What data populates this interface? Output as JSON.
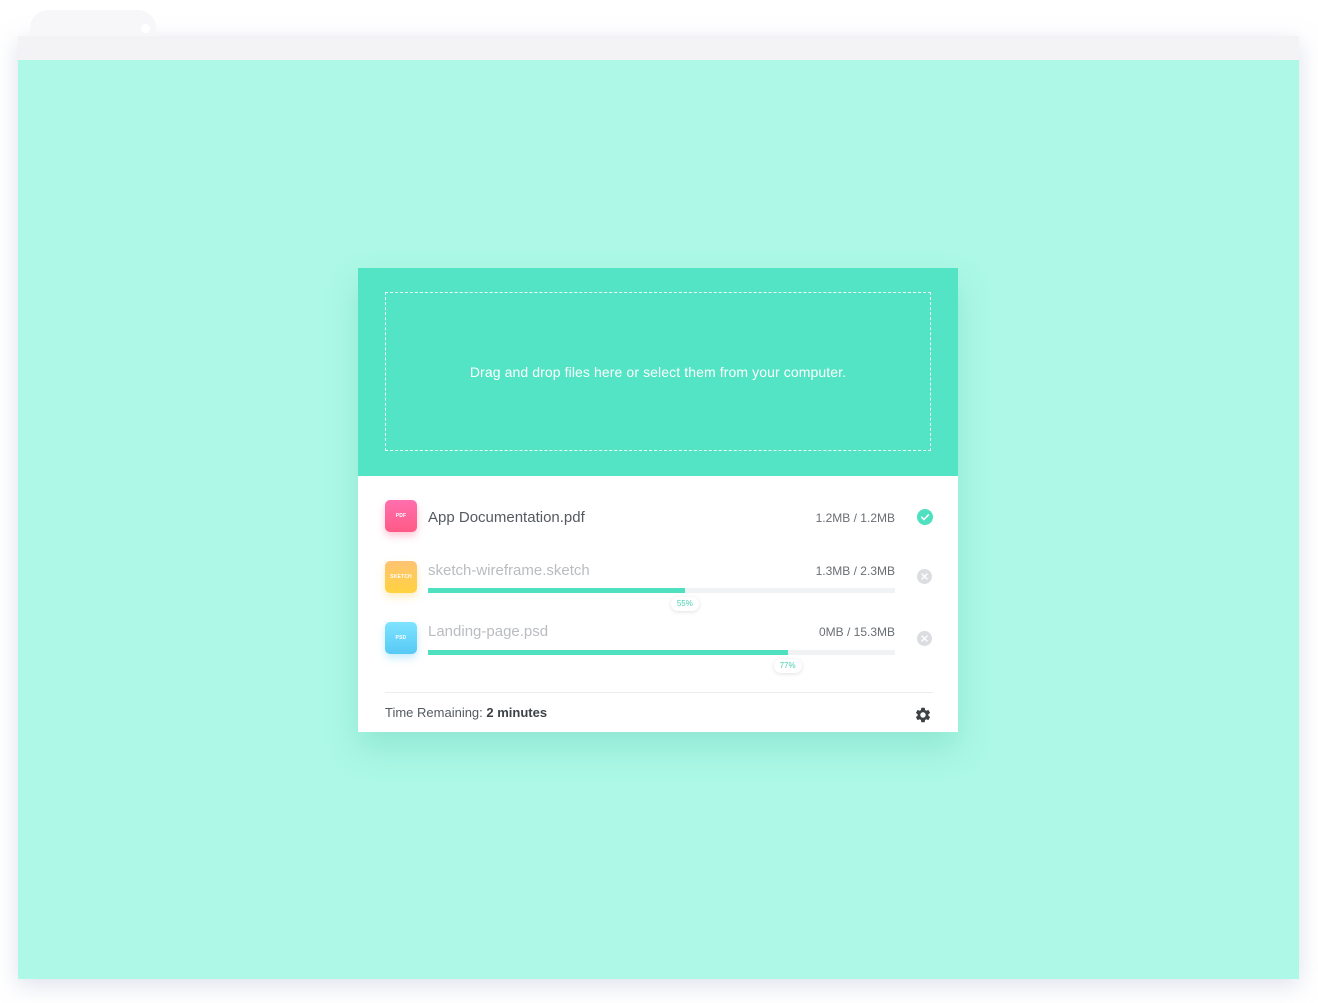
{
  "upload": {
    "drop_text": "Drag and drop files here or select them from your computer."
  },
  "files": [
    {
      "type_label": "PDF",
      "name": "App Documentation.pdf",
      "size": "1.2MB / 1.2MB",
      "status": "complete"
    },
    {
      "type_label": "SKETCH",
      "name": "sketch-wireframe.sketch",
      "size": "1.3MB / 2.3MB",
      "status": "uploading",
      "progress": 0.55,
      "progress_label": "55%"
    },
    {
      "type_label": "PSD",
      "name": "Landing-page.psd",
      "size": "0MB / 15.3MB",
      "status": "uploading",
      "progress": 0.77,
      "progress_label": "77%"
    }
  ],
  "footer": {
    "time_label": "Time Remaining: ",
    "time_value": "2 minutes"
  },
  "icons": {
    "complete": "check-circle-icon",
    "cancel": "close-circle-icon",
    "settings": "gear-icon"
  },
  "colors": {
    "page_background": "#adf8e6",
    "accent": "#52e4c4",
    "progress": "#4fe1bf",
    "pdf": "#ff5a86",
    "sketch": "#ffd23f",
    "psd": "#57c9f5"
  }
}
